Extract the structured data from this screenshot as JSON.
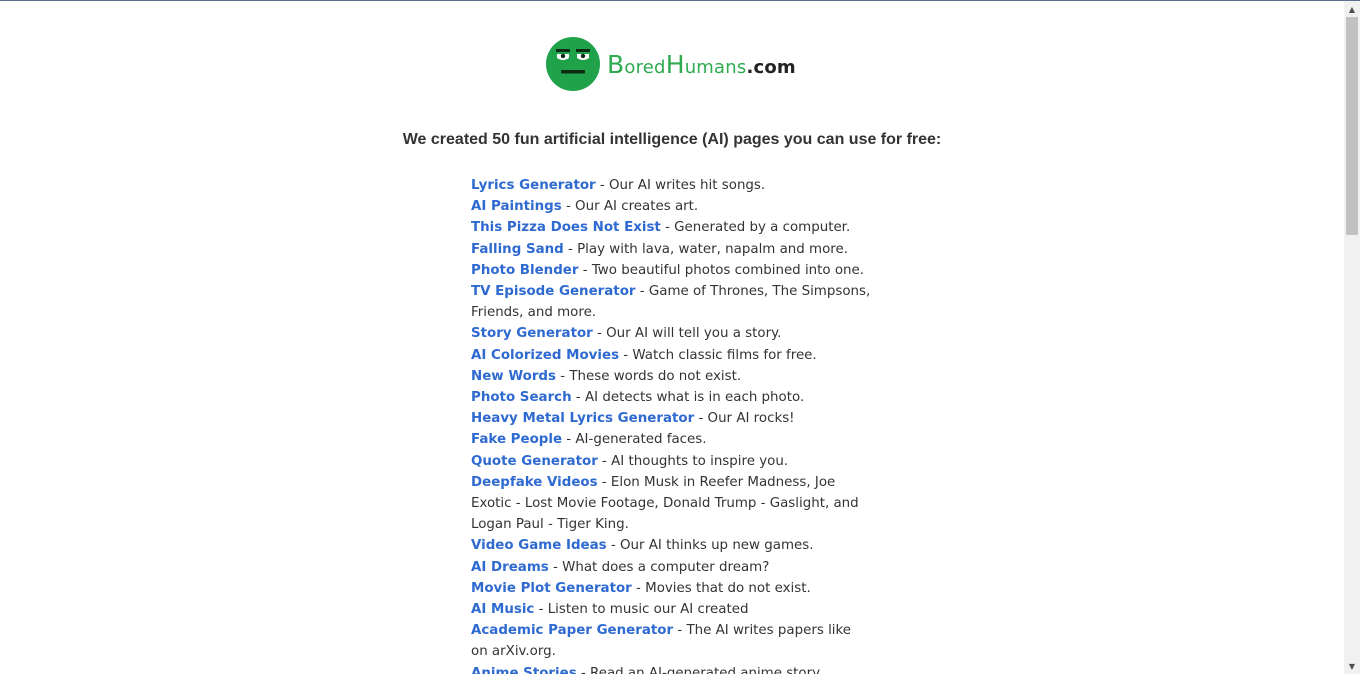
{
  "logo": {
    "letters": {
      "b": "B",
      "ored": "ored",
      "h": "H",
      "umans": "umans",
      "dotcom": ".com"
    },
    "brand_color": "#2eaa4f"
  },
  "headline": "We created 50 fun artificial intelligence (AI) pages you can use for free:",
  "items": [
    {
      "title": "Lyrics Generator",
      "desc": " - Our AI writes hit songs."
    },
    {
      "title": "AI Paintings",
      "desc": " - Our AI creates art."
    },
    {
      "title": "This Pizza Does Not Exist",
      "desc": " - Generated by a computer."
    },
    {
      "title": "Falling Sand",
      "desc": " - Play with lava, water, napalm and more."
    },
    {
      "title": "Photo Blender",
      "desc": " - Two beautiful photos combined into one."
    },
    {
      "title": "TV Episode Generator",
      "desc": " - Game of Thrones, The Simpsons, Friends, and more."
    },
    {
      "title": "Story Generator",
      "desc": " - Our AI will tell you a story."
    },
    {
      "title": "AI Colorized Movies",
      "desc": " - Watch classic films for free."
    },
    {
      "title": "New Words",
      "desc": " - These words do not exist."
    },
    {
      "title": "Photo Search",
      "desc": " - AI detects what is in each photo."
    },
    {
      "title": "Heavy Metal Lyrics Generator",
      "desc": " - Our AI rocks!"
    },
    {
      "title": "Fake People",
      "desc": " - AI-generated faces."
    },
    {
      "title": "Quote Generator",
      "desc": " - AI thoughts to inspire you."
    },
    {
      "title": "Deepfake Videos",
      "desc": " - Elon Musk in Reefer Madness, Joe Exotic - Lost Movie Footage, Donald Trump - Gaslight, and Logan Paul - Tiger King."
    },
    {
      "title": "Video Game Ideas",
      "desc": " - Our AI thinks up new games."
    },
    {
      "title": "AI Dreams",
      "desc": " - What does a computer dream?"
    },
    {
      "title": "Movie Plot Generator",
      "desc": " - Movies that do not exist."
    },
    {
      "title": "AI Music",
      "desc": " - Listen to music our AI created"
    },
    {
      "title": "Academic Paper Generator",
      "desc": " - The AI writes papers like on arXiv.org."
    },
    {
      "title": "Anime Stories",
      "desc": " - Read an AI-generated anime story."
    }
  ],
  "colors": {
    "link": "#2f6ad1",
    "text": "#333333",
    "background": "#ffffff"
  },
  "scrollbar": {
    "up_arrow": "▲",
    "down_arrow": "▼"
  }
}
